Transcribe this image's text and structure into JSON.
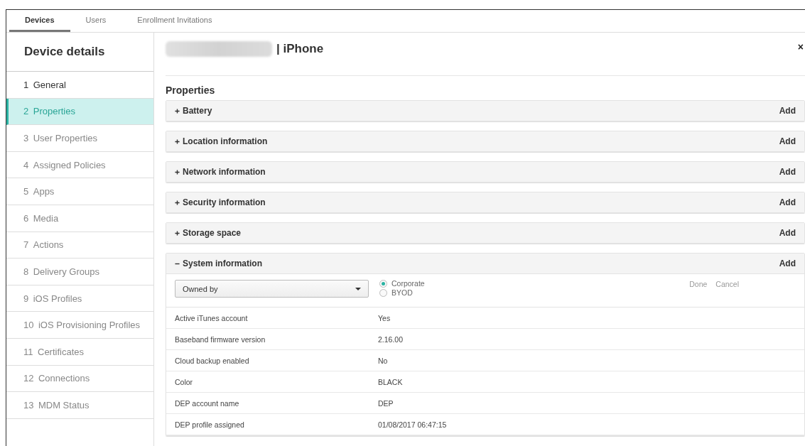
{
  "tabs": [
    {
      "label": "Devices",
      "selected": true
    },
    {
      "label": "Users",
      "selected": false
    },
    {
      "label": "Enrollment Invitations",
      "selected": false
    }
  ],
  "sidebar": {
    "title": "Device details",
    "items": [
      {
        "number": "1",
        "label": "General",
        "selected": false
      },
      {
        "number": "2",
        "label": "Properties",
        "selected": true
      },
      {
        "number": "3",
        "label": "User Properties",
        "selected": false
      },
      {
        "number": "4",
        "label": "Assigned Policies",
        "selected": false
      },
      {
        "number": "5",
        "label": "Apps",
        "selected": false
      },
      {
        "number": "6",
        "label": "Media",
        "selected": false
      },
      {
        "number": "7",
        "label": "Actions",
        "selected": false
      },
      {
        "number": "8",
        "label": "Delivery Groups",
        "selected": false
      },
      {
        "number": "9",
        "label": "iOS Profiles",
        "selected": false
      },
      {
        "number": "10",
        "label": "iOS Provisioning Profiles",
        "selected": false
      },
      {
        "number": "11",
        "label": "Certificates",
        "selected": false
      },
      {
        "number": "12",
        "label": "Connections",
        "selected": false
      },
      {
        "number": "13",
        "label": "MDM Status",
        "selected": false
      }
    ]
  },
  "header": {
    "title": "| iPhone",
    "close": "×"
  },
  "properties": {
    "title": "Properties",
    "sections": [
      {
        "label": "Battery",
        "expanded": false,
        "action": "Add"
      },
      {
        "label": "Location information",
        "expanded": false,
        "action": "Add"
      },
      {
        "label": "Network information",
        "expanded": false,
        "action": "Add"
      },
      {
        "label": "Security information",
        "expanded": false,
        "action": "Add"
      },
      {
        "label": "Storage space",
        "expanded": false,
        "action": "Add"
      },
      {
        "label": "System information",
        "expanded": true,
        "action": "Add"
      }
    ]
  },
  "system_information": {
    "owned_by": {
      "value": "Owned by",
      "options": [
        {
          "label": "Corporate",
          "selected": true
        },
        {
          "label": "BYOD",
          "selected": false
        }
      ],
      "done": "Done",
      "cancel": "Cancel"
    },
    "rows": [
      {
        "name": "Active iTunes account",
        "value": "Yes"
      },
      {
        "name": "Baseband firmware version",
        "value": "2.16.00"
      },
      {
        "name": "Cloud backup enabled",
        "value": "No"
      },
      {
        "name": "Color",
        "value": "BLACK"
      },
      {
        "name": "DEP account name",
        "value": "DEP"
      },
      {
        "name": "DEP profile assigned",
        "value": "01/08/2017 06:47:15"
      }
    ]
  }
}
